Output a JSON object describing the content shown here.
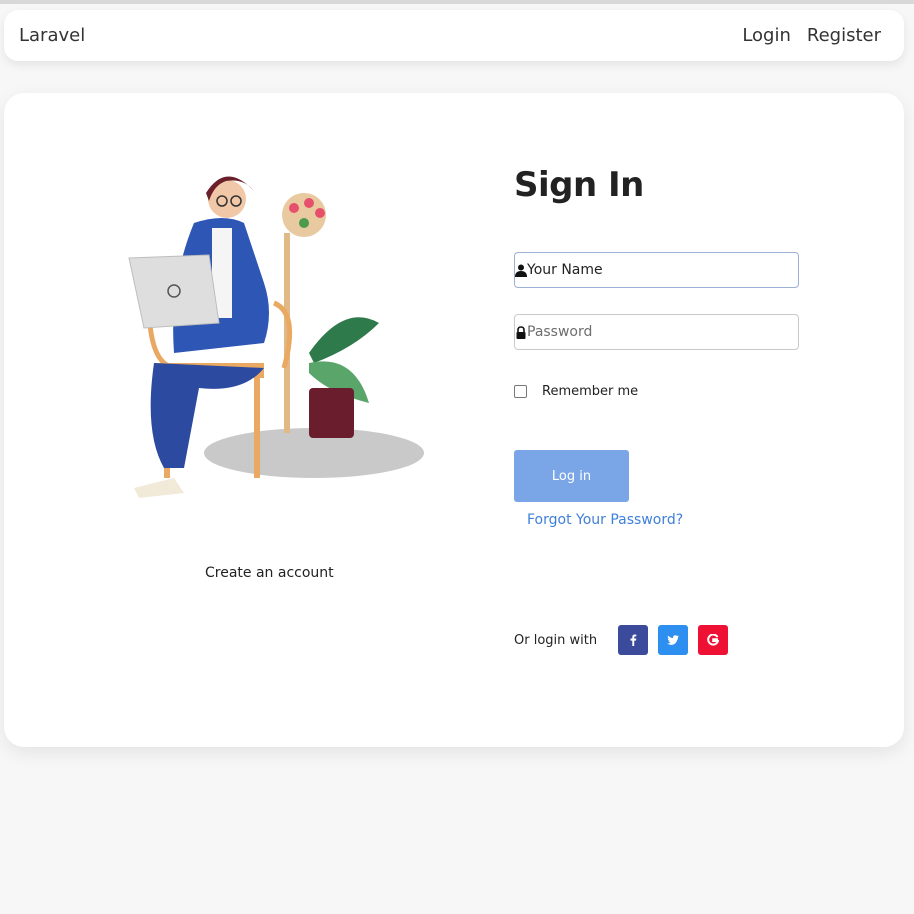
{
  "navbar": {
    "brand": "Laravel",
    "links": [
      "Login",
      "Register"
    ]
  },
  "left_panel": {
    "illustration": "person-with-laptop-illustration",
    "create_account": "Create an account"
  },
  "form": {
    "title": "Sign In",
    "name_field": {
      "value": "Your Name",
      "icon": "user-icon"
    },
    "password_field": {
      "placeholder": "Password",
      "icon": "lock-icon"
    },
    "remember_label": "Remember me",
    "login_button": "Log in",
    "forgot": "Forgot Your Password?",
    "social": {
      "label": "Or login with",
      "buttons": [
        {
          "name": "facebook",
          "icon": "facebook-icon",
          "color": "#3b4a9b"
        },
        {
          "name": "twitter",
          "icon": "twitter-icon",
          "color": "#2d8ff0"
        },
        {
          "name": "google",
          "icon": "google-icon",
          "color": "#ee1133"
        }
      ]
    }
  },
  "colors": {
    "background": "#f7f7f7",
    "accent": "#7aa6e8",
    "link": "#3f7fd9"
  }
}
